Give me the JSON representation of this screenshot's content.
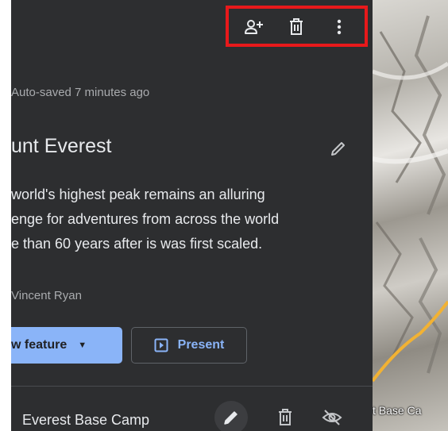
{
  "toolbar": {
    "add_collaborator_icon": "person-add-icon",
    "delete_icon": "trash-icon",
    "more_icon": "more-vert-icon"
  },
  "project": {
    "autosave_status": "Auto-saved 7 minutes ago",
    "title": "unt Everest",
    "description_lines": [
      "world's highest peak remains an alluring",
      "enge for adventures from across the world",
      "e than 60 years after is was first scaled."
    ],
    "author": "Vincent Ryan"
  },
  "actions": {
    "new_feature_label": "w feature",
    "present_label": "Present"
  },
  "feature": {
    "name": "Everest Base Camp"
  },
  "map": {
    "label": "t Base Ca"
  },
  "colors": {
    "panel_bg": "#2d2e30",
    "accent": "#8ab4f8",
    "highlight_border": "#e8191b",
    "route": "#f2b233"
  }
}
